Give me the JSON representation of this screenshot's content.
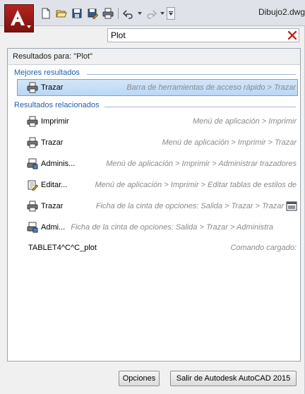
{
  "window": {
    "title": "Dibujo2.dwg"
  },
  "qat": {
    "icons": [
      "new-icon",
      "open-icon",
      "save-icon",
      "save-as-icon",
      "plot-icon",
      "undo-icon",
      "redo-icon",
      "customize-icon"
    ]
  },
  "search": {
    "value": "Plot",
    "placeholder": ""
  },
  "results": {
    "header": "Resultados para: \"Plot\"",
    "best_title": "Mejores resultados",
    "best": [
      {
        "icon": "printer-icon",
        "label": "Trazar",
        "path": "Barra de herramientas de acceso rápido > Trazar"
      }
    ],
    "related_title": "Resultados relacionados",
    "related": [
      {
        "icon": "printer-icon",
        "label": "Imprimir",
        "path": "Menú de aplicación > Imprimir"
      },
      {
        "icon": "printer-icon",
        "label": "Trazar",
        "path": "Menú de aplicación > Imprimir > Trazar"
      },
      {
        "icon": "plotter-manager-icon",
        "label": "Adminis...",
        "path": "Menú de aplicación > Imprimir > Administrar trazadores"
      },
      {
        "icon": "edit-plot-styles-icon",
        "label": "Editar...",
        "path": "Menú de aplicación > Imprimir > Editar tablas de estilos de"
      },
      {
        "icon": "printer-icon",
        "label": "Trazar",
        "path": "Ficha de la cinta de opciones: Salida > Trazar > Trazar",
        "tail_icon": "ribbon-panel-icon"
      },
      {
        "icon": "plotter-manager-icon",
        "label": "Admi...",
        "path": "Ficha de la cinta de opciones: Salida > Trazar > Administra"
      },
      {
        "icon": "",
        "label": "TABLET4^C^C_plot",
        "path": "Comando cargado:"
      }
    ]
  },
  "buttons": {
    "options": "Opciones",
    "exit": "Salir de Autodesk AutoCAD 2015"
  },
  "colors": {
    "app_button": "#a31d16",
    "group_title": "#1f5fb0",
    "selection": "#bad7f5",
    "path_text": "#8a8a8a"
  }
}
